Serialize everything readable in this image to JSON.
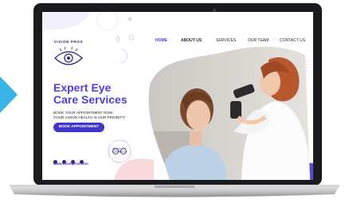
{
  "logo": {
    "text": "VISION PROS"
  },
  "nav": {
    "items": [
      "HOME",
      "ABOUT US",
      "SERVICES",
      "OUR TEAM",
      "CONTACT US"
    ],
    "active": "HOME"
  },
  "hero": {
    "title_line1": "Expert Eye",
    "title_line2": "Care Services",
    "subtitle_line1": "BOOK YOUR APPOINTMENT NOW",
    "subtitle_line2": "YOUR VISION HEALTH IS OUR PRIORITY!",
    "button": "BOOK APPOINTMENT"
  },
  "footer": {
    "website": "www.visionpros.com"
  },
  "badge": {
    "text": "QUALITY SERVICE"
  },
  "colors": {
    "brand": "#4d3ee0",
    "button": "#4534c9",
    "navy": "#2d2a7a",
    "accent_blue": "#3ab3e6",
    "pink": "#f5d5da"
  },
  "icons": {
    "social": [
      "facebook-icon",
      "twitter-icon",
      "instagram-icon",
      "youtube-icon"
    ]
  }
}
